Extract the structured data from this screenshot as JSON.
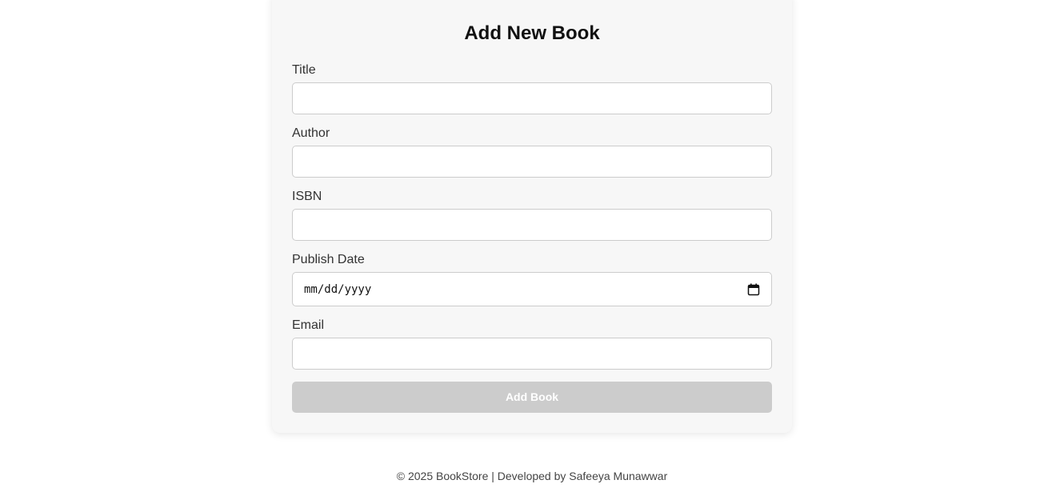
{
  "form": {
    "title": "Add New Book",
    "fields": {
      "title": {
        "label": "Title",
        "value": ""
      },
      "author": {
        "label": "Author",
        "value": ""
      },
      "isbn": {
        "label": "ISBN",
        "value": ""
      },
      "publish_date": {
        "label": "Publish Date",
        "placeholder": "mm/dd/yyyy",
        "icon": "calendar-icon"
      },
      "email": {
        "label": "Email",
        "value": ""
      }
    },
    "submit_label": "Add Book",
    "submit_state": "disabled"
  },
  "footer": {
    "text": "© 2025 BookStore | Developed by Safeeya Munawwar"
  },
  "colors": {
    "card_bg": "#f7f7f7",
    "button_disabled": "#cccccc",
    "border": "#cccccc"
  }
}
